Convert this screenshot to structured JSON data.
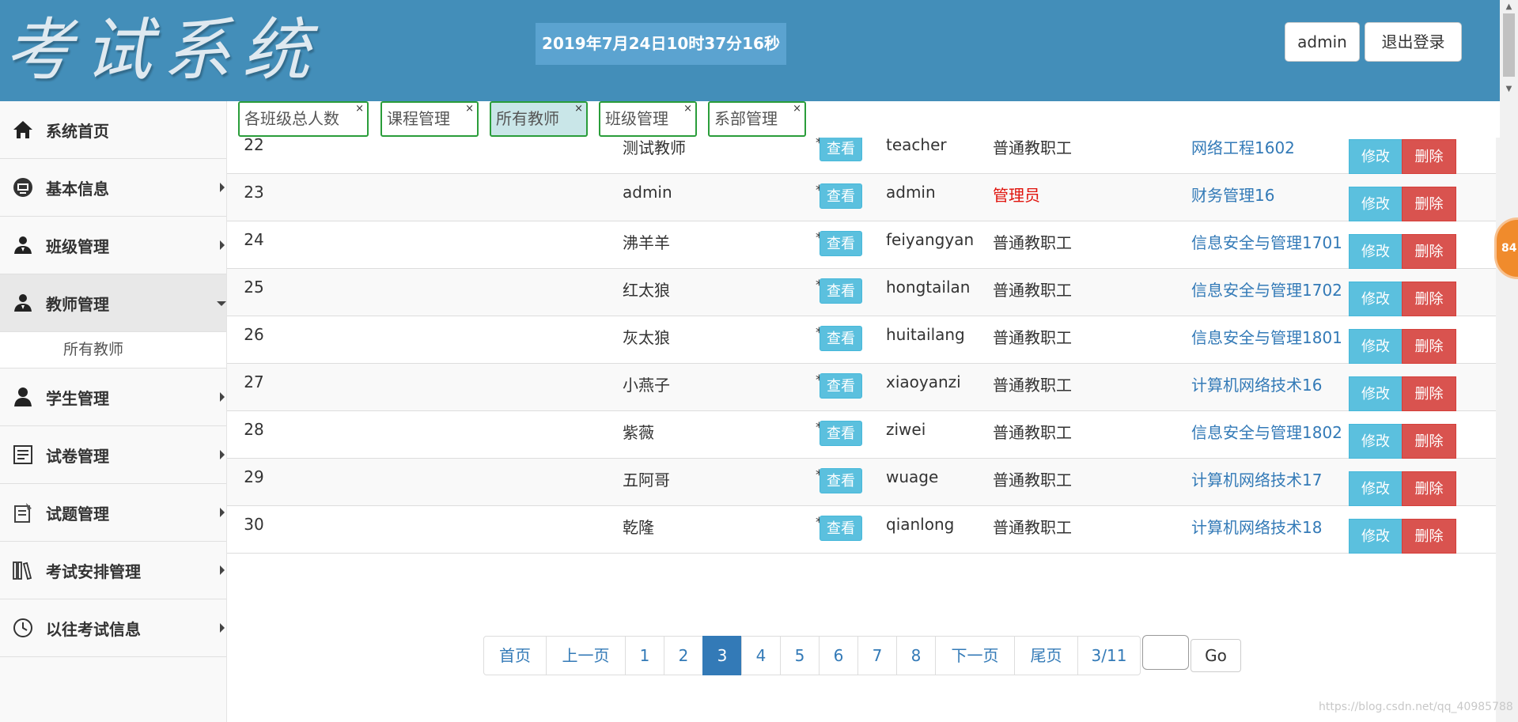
{
  "header": {
    "logo_text": "考试系统",
    "datetime": "2019年7月24日10时37分16秒",
    "user_label": "admin",
    "logout_label": "退出登录"
  },
  "sidebar": {
    "items": [
      {
        "label": "系统首页",
        "icon": "home-icon",
        "has_arrow": false
      },
      {
        "label": "基本信息",
        "icon": "id-card-icon",
        "has_arrow": true
      },
      {
        "label": "班级管理",
        "icon": "users-icon",
        "has_arrow": true
      },
      {
        "label": "教师管理",
        "icon": "teacher-icon",
        "has_arrow": true,
        "expanded": true
      },
      {
        "label": "学生管理",
        "icon": "student-icon",
        "has_arrow": true
      },
      {
        "label": "试卷管理",
        "icon": "paper-icon",
        "has_arrow": true
      },
      {
        "label": "试题管理",
        "icon": "question-icon",
        "has_arrow": true
      },
      {
        "label": "考试安排管理",
        "icon": "books-icon",
        "has_arrow": true
      },
      {
        "label": "以往考试信息",
        "icon": "clock-icon",
        "has_arrow": true
      }
    ],
    "sub_item": "所有教师"
  },
  "tabs": [
    {
      "label": "各班级总人数",
      "active": false
    },
    {
      "label": "课程管理",
      "active": false
    },
    {
      "label": "所有教师",
      "active": true
    },
    {
      "label": "班级管理",
      "active": false
    },
    {
      "label": "系部管理",
      "active": false
    }
  ],
  "tab_close": "×",
  "table": {
    "view_label": "查看",
    "edit_label": "修改",
    "delete_label": "删除",
    "rows": [
      {
        "id": "22",
        "name": "测试教师",
        "username": "teacher",
        "password": "******",
        "role": "普通教职工",
        "class": "网络工程1602"
      },
      {
        "id": "23",
        "name": "admin",
        "username": "admin",
        "password": "******",
        "role": "管理员",
        "class": "财务管理16"
      },
      {
        "id": "24",
        "name": "沸羊羊",
        "username": "feiyangyan",
        "password": "******",
        "role": "普通教职工",
        "class": "信息安全与管理1701"
      },
      {
        "id": "25",
        "name": "红太狼",
        "username": "hongtailan",
        "password": "******",
        "role": "普通教职工",
        "class": "信息安全与管理1702"
      },
      {
        "id": "26",
        "name": "灰太狼",
        "username": "huitailang",
        "password": "******",
        "role": "普通教职工",
        "class": "信息安全与管理1801"
      },
      {
        "id": "27",
        "name": "小燕子",
        "username": "xiaoyanzi",
        "password": "******",
        "role": "普通教职工",
        "class": "计算机网络技术16"
      },
      {
        "id": "28",
        "name": "紫薇",
        "username": "ziwei",
        "password": "******",
        "role": "普通教职工",
        "class": "信息安全与管理1802"
      },
      {
        "id": "29",
        "name": "五阿哥",
        "username": "wuage",
        "password": "******",
        "role": "普通教职工",
        "class": "计算机网络技术17"
      },
      {
        "id": "30",
        "name": "乾隆",
        "username": "qianlong",
        "password": "******",
        "role": "普通教职工",
        "class": "计算机网络技术18"
      }
    ]
  },
  "pagination": {
    "first": "首页",
    "prev": "上一页",
    "pages": [
      "1",
      "2",
      "3",
      "4",
      "5",
      "6",
      "7",
      "8"
    ],
    "current": "3",
    "next": "下一页",
    "last": "尾页",
    "page_info": "3/11",
    "go_label": "Go"
  },
  "float_badge": "84",
  "watermark": "https://blog.csdn.net/qq_40985788",
  "colors": {
    "header_bg": "#438eb9",
    "info": "#5bc0de",
    "danger": "#d9534f",
    "link": "#337ab7",
    "tab_border": "#2a9d3a",
    "admin_role": "#e0130c"
  }
}
